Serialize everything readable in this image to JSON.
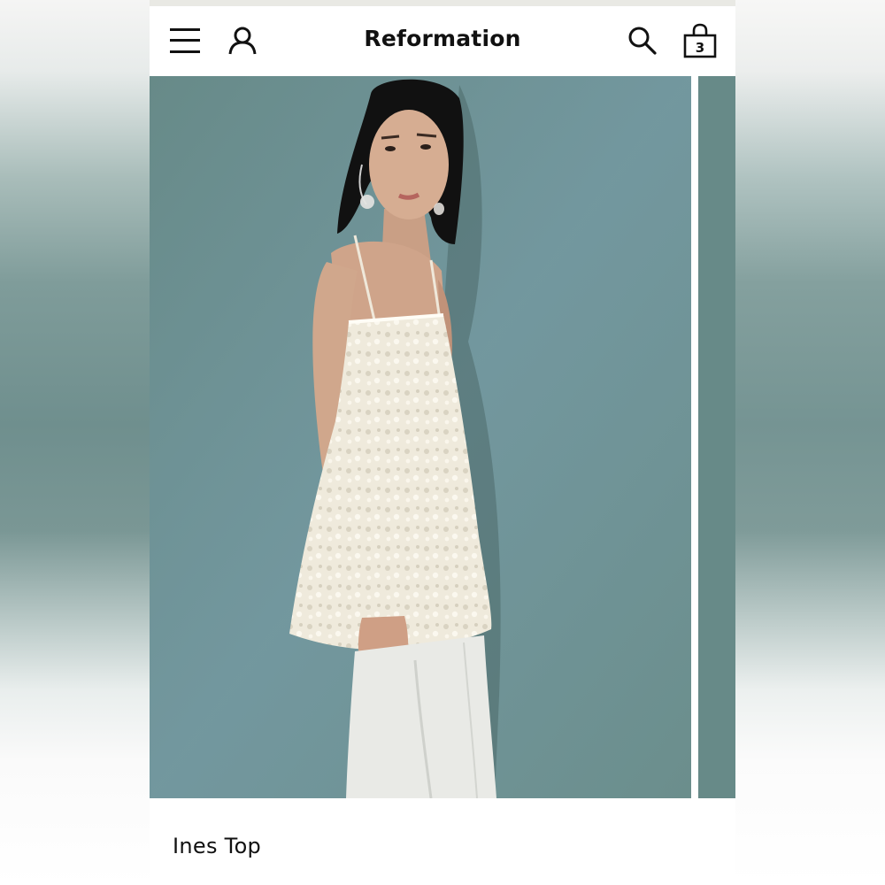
{
  "header": {
    "brand": "Reformation",
    "bag_count": "3"
  },
  "icons": [
    "menu-icon",
    "account-icon",
    "search-icon",
    "bag-icon"
  ],
  "product": {
    "title": "Ines Top",
    "image_alt": "Model wearing white textured cami top with white satin skirt against teal backdrop"
  },
  "colors": {
    "backdrop": "#6f9290",
    "text": "#111111",
    "top_garment": "#f1ede2"
  }
}
